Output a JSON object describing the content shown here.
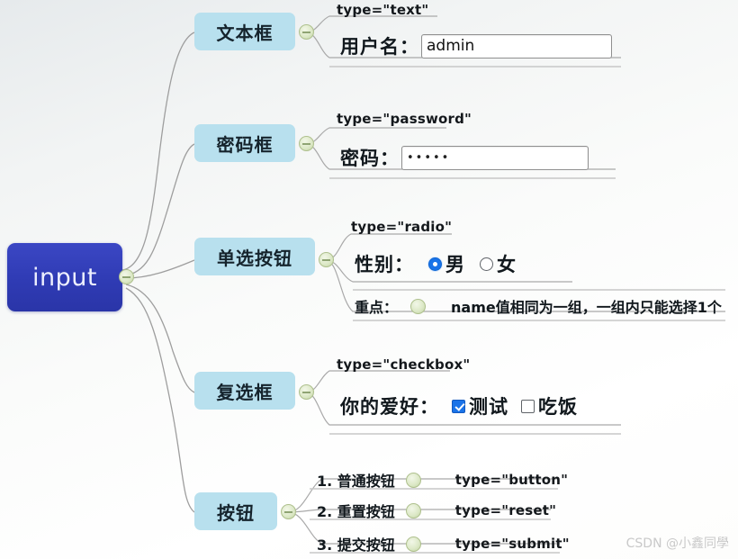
{
  "root": {
    "label": "input"
  },
  "branches": [
    {
      "label": "文本框"
    },
    {
      "label": "密码框"
    },
    {
      "label": "单选按钮"
    },
    {
      "label": "复选框"
    },
    {
      "label": "按钮"
    }
  ],
  "text_branch": {
    "type_label": "type=\"text\"",
    "field_label": "用户名：",
    "input_value": "admin"
  },
  "password_branch": {
    "type_label": "type=\"password\"",
    "field_label": "密码：",
    "input_value": "•••••"
  },
  "radio_branch": {
    "type_label": "type=\"radio\"",
    "field_label": "性别：",
    "option_male": "男",
    "option_female": "女",
    "note_label": "重点：",
    "note_text": "name值相同为一组，一组内只能选择1个"
  },
  "checkbox_branch": {
    "type_label": "type=\"checkbox\"",
    "field_label": "你的爱好：",
    "option_test": "测试",
    "option_eat": "吃饭"
  },
  "button_branch": {
    "items": [
      {
        "label": "1. 普通按钮",
        "type_label": "type=\"button\""
      },
      {
        "label": "2. 重置按钮",
        "type_label": "type=\"reset\""
      },
      {
        "label": "3. 提交按钮",
        "type_label": "type=\"submit\""
      }
    ]
  },
  "watermark": "CSDN @小鑫同學",
  "colors": {
    "root_blue": "#2f3bb4",
    "chip_blue": "#b8e0ee",
    "accent_blue": "#1a73e8",
    "link_gray": "#9a9a9a"
  }
}
